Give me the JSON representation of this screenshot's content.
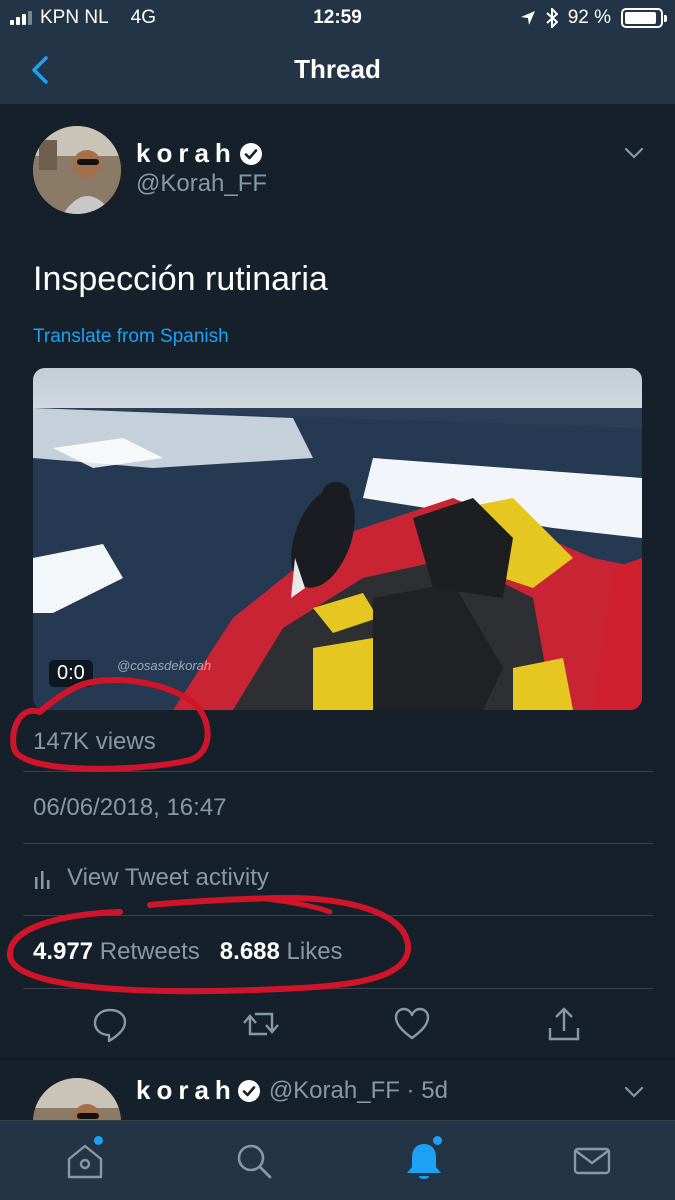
{
  "status_bar": {
    "carrier": "KPN NL",
    "network": "4G",
    "time": "12:59",
    "battery": "92 %"
  },
  "nav": {
    "title": "Thread"
  },
  "tweet": {
    "author_name": "korah",
    "author_handle": "@Korah_FF",
    "text": "Inspección rutinaria",
    "translate_label": "Translate from Spanish",
    "video_time": "0:0",
    "watermark": "@cosasdekorah",
    "views": "147K views",
    "timestamp": "06/06/2018, 16:47",
    "activity_label": "View Tweet activity",
    "retweets_count": "4.977",
    "retweets_label": "Retweets",
    "likes_count": "8.688",
    "likes_label": "Likes"
  },
  "reply": {
    "author_name": "korah",
    "author_handle": "@Korah_FF · 5d"
  },
  "colors": {
    "background": "#15202b",
    "bar": "#243447",
    "accent": "#1da1f2",
    "secondary_text": "#8899a6",
    "annotation": "#d0152a"
  },
  "icons": [
    "back-chevron-icon",
    "verified-badge-icon",
    "chevron-down-icon",
    "bar-chart-icon",
    "reply-icon",
    "retweet-icon",
    "like-icon",
    "share-icon",
    "home-icon",
    "search-icon",
    "notifications-icon",
    "messages-icon"
  ]
}
